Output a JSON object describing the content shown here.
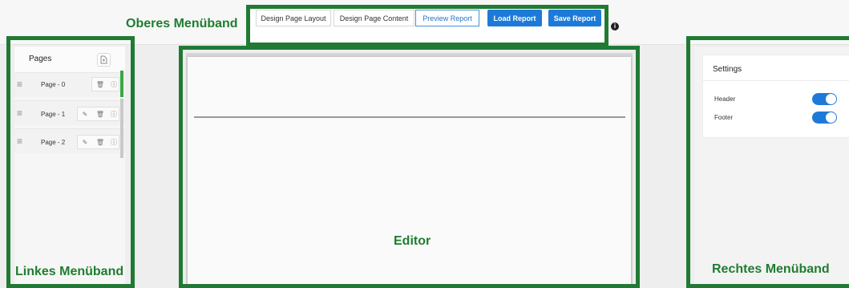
{
  "annotations": {
    "top": "Oberes Menüband",
    "left": "Linkes Menüband",
    "editor": "Editor",
    "right": "Rechtes Menüband"
  },
  "toolbar": {
    "design_layout": "Design Page Layout",
    "design_content": "Design Page Content",
    "preview": "Preview Report",
    "load": "Load Report",
    "save": "Save Report",
    "active_tab": "preview"
  },
  "left_panel": {
    "title": "Pages",
    "pages": [
      {
        "label": "Page - 0",
        "editable": false,
        "selected": true
      },
      {
        "label": "Page - 1",
        "editable": true,
        "selected": false
      },
      {
        "label": "Page - 2",
        "editable": true,
        "selected": false
      }
    ]
  },
  "settings": {
    "title": "Settings",
    "header_label": "Header",
    "header_on": true,
    "footer_label": "Footer",
    "footer_on": true
  },
  "colors": {
    "annotation_green": "#207a34",
    "primary_blue": "#1e7ad9",
    "selected_scroll": "#3aa847"
  },
  "icons": {
    "info": "info-icon",
    "add_page": "add-page-icon",
    "drag": "drag-handle-icon",
    "edit": "pencil-icon",
    "delete": "trash-icon",
    "page_info": "page-info-icon"
  }
}
